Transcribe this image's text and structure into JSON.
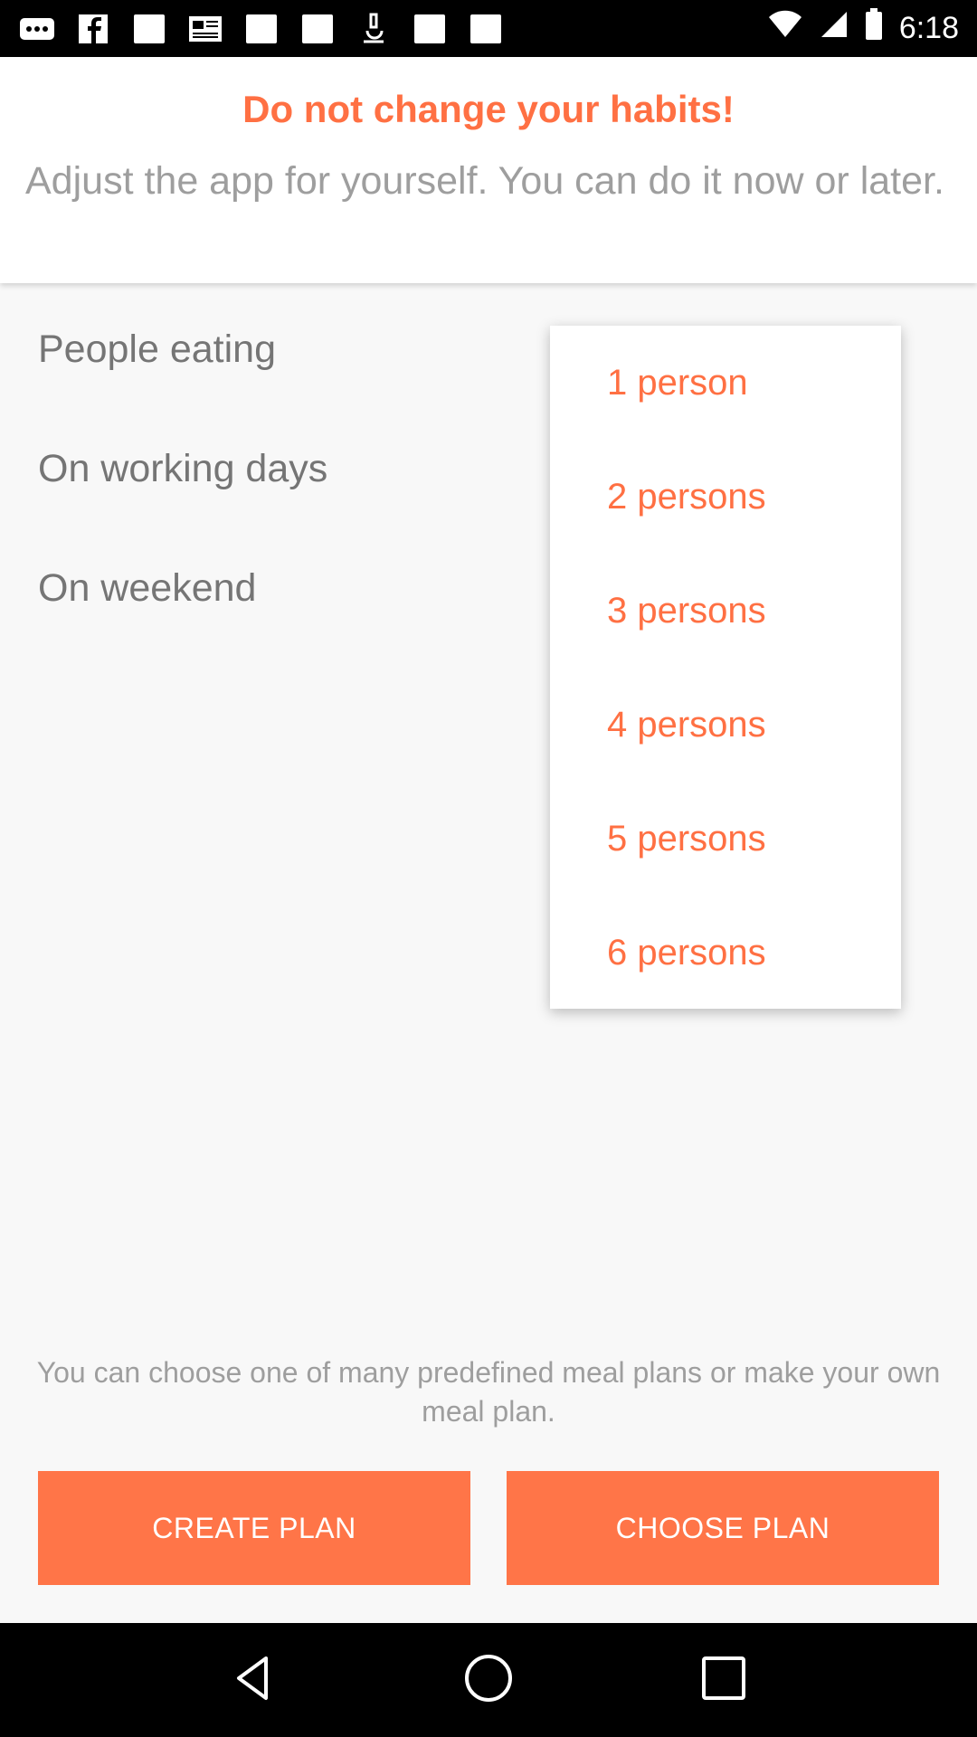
{
  "status_bar": {
    "time": "6:18",
    "icons": [
      "more-dots-icon",
      "facebook-icon",
      "blank-square-icon",
      "news-icon",
      "blank-square-icon",
      "blank-square-icon",
      "microscope-icon",
      "blank-square-icon",
      "blank-square-icon",
      "wifi-icon",
      "signal-icon",
      "battery-icon"
    ]
  },
  "header": {
    "title": "Do not change your habits!",
    "subtitle": "Adjust the app for yourself. You can do it now or later."
  },
  "settings": {
    "people_eating_label": "People eating",
    "working_days_label": "On working days",
    "weekend_label": "On weekend"
  },
  "dropdown": {
    "options": [
      "1 person",
      "2 persons",
      "3 persons",
      "4 persons",
      "5 persons",
      "6 persons"
    ]
  },
  "footer": {
    "info": "You can choose one of many predefined meal plans or make your own meal plan.",
    "create_label": "CREATE PLAN",
    "choose_label": "CHOOSE PLAN"
  },
  "nav": {
    "icons": [
      "back-icon",
      "home-icon",
      "recents-icon"
    ]
  },
  "colors": {
    "accent": "#ff7043",
    "button": "#ff7548",
    "text_gray": "#9e9e9e"
  }
}
